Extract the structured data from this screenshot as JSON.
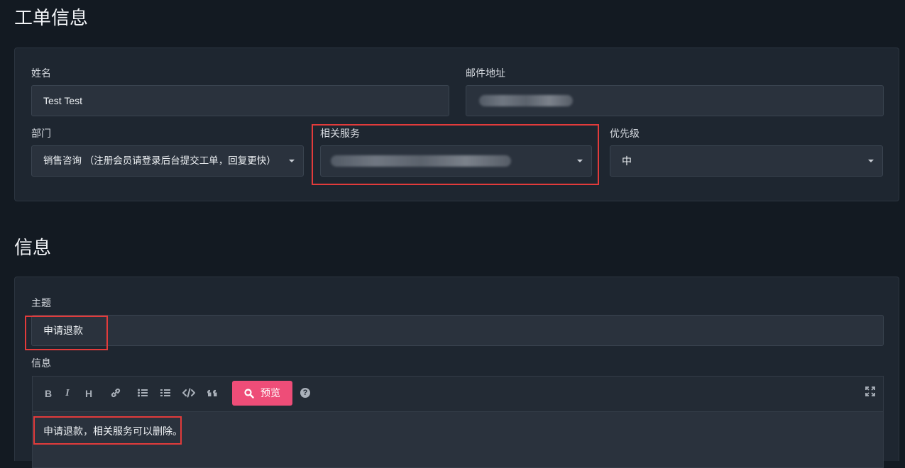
{
  "ticket_section": {
    "title": "工单信息",
    "name_label": "姓名",
    "name_value": "Test Test",
    "email_label": "邮件地址",
    "department_label": "部门",
    "department_value": "销售咨询 （注册会员请登录后台提交工单，回复更快）",
    "service_label": "相关服务",
    "priority_label": "优先级",
    "priority_value": "中"
  },
  "message_section": {
    "title": "信息",
    "subject_label": "主题",
    "subject_value": "申请退款",
    "message_label": "信息",
    "toolbar": {
      "bold": "B",
      "italic": "I",
      "heading": "H",
      "preview_label": "预览",
      "help": "?"
    },
    "editor_text": "申请退款，相关服务可以删除。"
  },
  "colors": {
    "background": "#131a22",
    "panel": "#1e2630",
    "field": "#2a323d",
    "accent_pink": "#ee4d78",
    "annotation_red": "#e23b3b"
  },
  "icons": [
    "bold-icon",
    "italic-icon",
    "heading-icon",
    "link-icon",
    "bullet-list-icon",
    "numbered-list-icon",
    "code-icon",
    "quote-icon",
    "search-icon",
    "help-icon",
    "fullscreen-icon",
    "caret-down-icon"
  ]
}
